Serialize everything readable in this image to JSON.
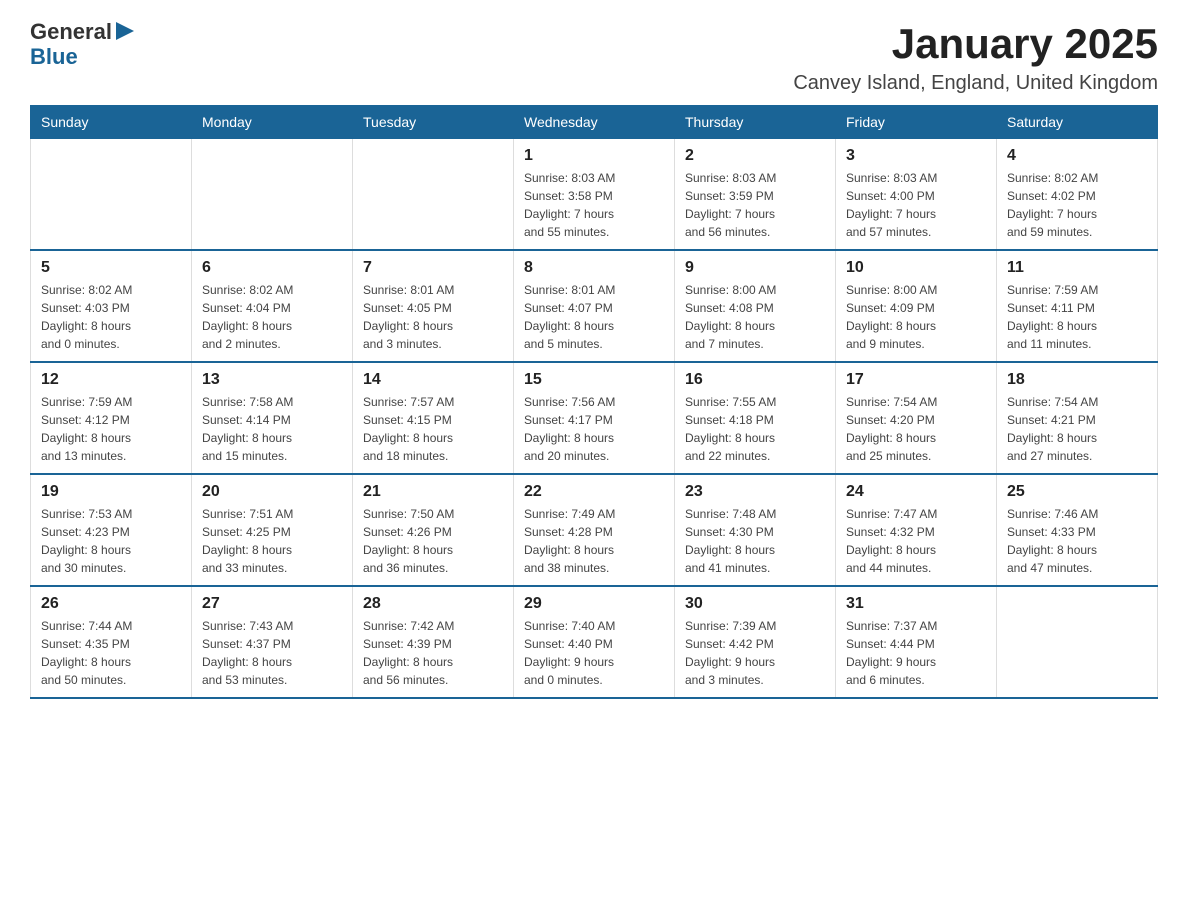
{
  "logo": {
    "general": "General",
    "blue": "Blue"
  },
  "title": "January 2025",
  "subtitle": "Canvey Island, England, United Kingdom",
  "days_of_week": [
    "Sunday",
    "Monday",
    "Tuesday",
    "Wednesday",
    "Thursday",
    "Friday",
    "Saturday"
  ],
  "weeks": [
    [
      {
        "day": "",
        "info": ""
      },
      {
        "day": "",
        "info": ""
      },
      {
        "day": "",
        "info": ""
      },
      {
        "day": "1",
        "info": "Sunrise: 8:03 AM\nSunset: 3:58 PM\nDaylight: 7 hours\nand 55 minutes."
      },
      {
        "day": "2",
        "info": "Sunrise: 8:03 AM\nSunset: 3:59 PM\nDaylight: 7 hours\nand 56 minutes."
      },
      {
        "day": "3",
        "info": "Sunrise: 8:03 AM\nSunset: 4:00 PM\nDaylight: 7 hours\nand 57 minutes."
      },
      {
        "day": "4",
        "info": "Sunrise: 8:02 AM\nSunset: 4:02 PM\nDaylight: 7 hours\nand 59 minutes."
      }
    ],
    [
      {
        "day": "5",
        "info": "Sunrise: 8:02 AM\nSunset: 4:03 PM\nDaylight: 8 hours\nand 0 minutes."
      },
      {
        "day": "6",
        "info": "Sunrise: 8:02 AM\nSunset: 4:04 PM\nDaylight: 8 hours\nand 2 minutes."
      },
      {
        "day": "7",
        "info": "Sunrise: 8:01 AM\nSunset: 4:05 PM\nDaylight: 8 hours\nand 3 minutes."
      },
      {
        "day": "8",
        "info": "Sunrise: 8:01 AM\nSunset: 4:07 PM\nDaylight: 8 hours\nand 5 minutes."
      },
      {
        "day": "9",
        "info": "Sunrise: 8:00 AM\nSunset: 4:08 PM\nDaylight: 8 hours\nand 7 minutes."
      },
      {
        "day": "10",
        "info": "Sunrise: 8:00 AM\nSunset: 4:09 PM\nDaylight: 8 hours\nand 9 minutes."
      },
      {
        "day": "11",
        "info": "Sunrise: 7:59 AM\nSunset: 4:11 PM\nDaylight: 8 hours\nand 11 minutes."
      }
    ],
    [
      {
        "day": "12",
        "info": "Sunrise: 7:59 AM\nSunset: 4:12 PM\nDaylight: 8 hours\nand 13 minutes."
      },
      {
        "day": "13",
        "info": "Sunrise: 7:58 AM\nSunset: 4:14 PM\nDaylight: 8 hours\nand 15 minutes."
      },
      {
        "day": "14",
        "info": "Sunrise: 7:57 AM\nSunset: 4:15 PM\nDaylight: 8 hours\nand 18 minutes."
      },
      {
        "day": "15",
        "info": "Sunrise: 7:56 AM\nSunset: 4:17 PM\nDaylight: 8 hours\nand 20 minutes."
      },
      {
        "day": "16",
        "info": "Sunrise: 7:55 AM\nSunset: 4:18 PM\nDaylight: 8 hours\nand 22 minutes."
      },
      {
        "day": "17",
        "info": "Sunrise: 7:54 AM\nSunset: 4:20 PM\nDaylight: 8 hours\nand 25 minutes."
      },
      {
        "day": "18",
        "info": "Sunrise: 7:54 AM\nSunset: 4:21 PM\nDaylight: 8 hours\nand 27 minutes."
      }
    ],
    [
      {
        "day": "19",
        "info": "Sunrise: 7:53 AM\nSunset: 4:23 PM\nDaylight: 8 hours\nand 30 minutes."
      },
      {
        "day": "20",
        "info": "Sunrise: 7:51 AM\nSunset: 4:25 PM\nDaylight: 8 hours\nand 33 minutes."
      },
      {
        "day": "21",
        "info": "Sunrise: 7:50 AM\nSunset: 4:26 PM\nDaylight: 8 hours\nand 36 minutes."
      },
      {
        "day": "22",
        "info": "Sunrise: 7:49 AM\nSunset: 4:28 PM\nDaylight: 8 hours\nand 38 minutes."
      },
      {
        "day": "23",
        "info": "Sunrise: 7:48 AM\nSunset: 4:30 PM\nDaylight: 8 hours\nand 41 minutes."
      },
      {
        "day": "24",
        "info": "Sunrise: 7:47 AM\nSunset: 4:32 PM\nDaylight: 8 hours\nand 44 minutes."
      },
      {
        "day": "25",
        "info": "Sunrise: 7:46 AM\nSunset: 4:33 PM\nDaylight: 8 hours\nand 47 minutes."
      }
    ],
    [
      {
        "day": "26",
        "info": "Sunrise: 7:44 AM\nSunset: 4:35 PM\nDaylight: 8 hours\nand 50 minutes."
      },
      {
        "day": "27",
        "info": "Sunrise: 7:43 AM\nSunset: 4:37 PM\nDaylight: 8 hours\nand 53 minutes."
      },
      {
        "day": "28",
        "info": "Sunrise: 7:42 AM\nSunset: 4:39 PM\nDaylight: 8 hours\nand 56 minutes."
      },
      {
        "day": "29",
        "info": "Sunrise: 7:40 AM\nSunset: 4:40 PM\nDaylight: 9 hours\nand 0 minutes."
      },
      {
        "day": "30",
        "info": "Sunrise: 7:39 AM\nSunset: 4:42 PM\nDaylight: 9 hours\nand 3 minutes."
      },
      {
        "day": "31",
        "info": "Sunrise: 7:37 AM\nSunset: 4:44 PM\nDaylight: 9 hours\nand 6 minutes."
      },
      {
        "day": "",
        "info": ""
      }
    ]
  ]
}
